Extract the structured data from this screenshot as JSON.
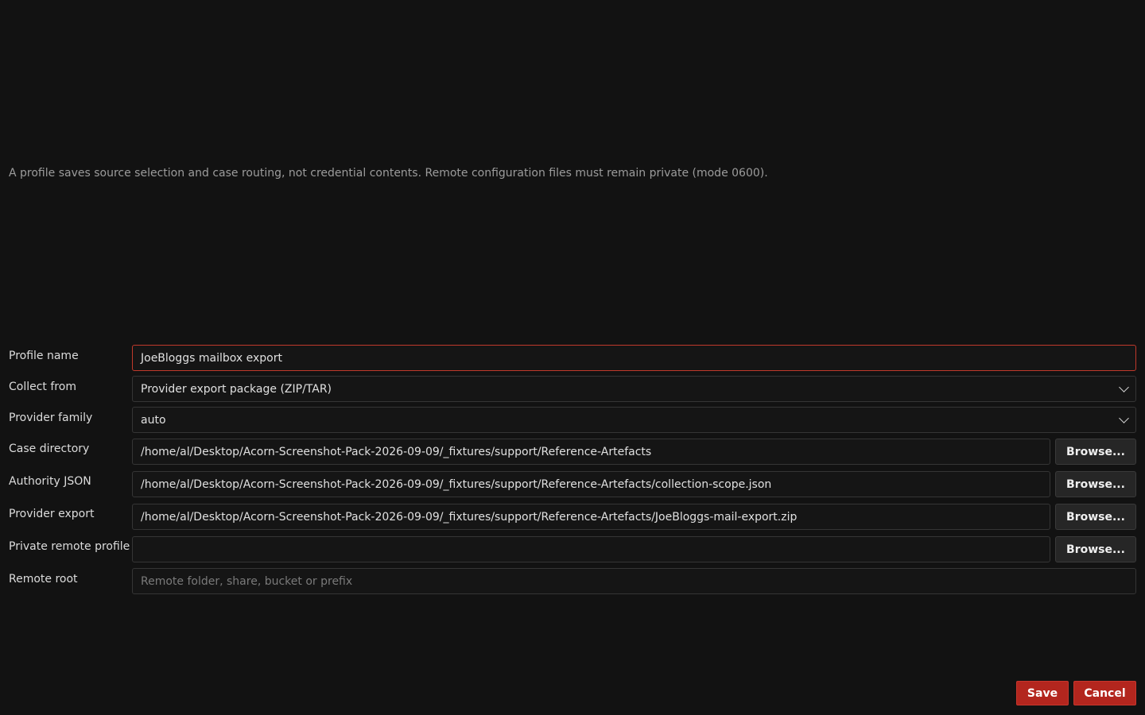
{
  "note": "A profile saves source selection and case routing, not credential contents. Remote configuration files must remain private (mode 0600).",
  "form": {
    "profile_name": {
      "label": "Profile name",
      "value": "JoeBloggs mailbox export"
    },
    "collect_from": {
      "label": "Collect from",
      "value": "Provider export package (ZIP/TAR)"
    },
    "provider_family": {
      "label": "Provider family",
      "value": "auto"
    },
    "case_directory": {
      "label": "Case directory",
      "value": "/home/al/Desktop/Acorn-Screenshot-Pack-2026-09-09/_fixtures/support/Reference-Artefacts",
      "browse_label": "Browse..."
    },
    "authority_json": {
      "label": "Authority JSON",
      "value": "/home/al/Desktop/Acorn-Screenshot-Pack-2026-09-09/_fixtures/support/Reference-Artefacts/collection-scope.json",
      "browse_label": "Browse..."
    },
    "provider_export": {
      "label": "Provider export",
      "value": "/home/al/Desktop/Acorn-Screenshot-Pack-2026-09-09/_fixtures/support/Reference-Artefacts/JoeBloggs-mail-export.zip",
      "browse_label": "Browse..."
    },
    "private_remote_profile": {
      "label": "Private remote profile",
      "value": "",
      "browse_label": "Browse..."
    },
    "remote_root": {
      "label": "Remote root",
      "value": "",
      "placeholder": "Remote folder, share, bucket or prefix"
    }
  },
  "actions": {
    "save_label": "Save",
    "cancel_label": "Cancel"
  },
  "colors": {
    "background": "#121212",
    "accent": "#b3261e",
    "active_border": "#c0392b"
  }
}
